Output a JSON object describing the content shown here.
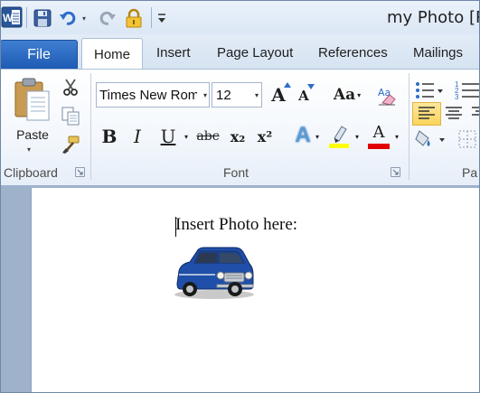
{
  "quick_access": {
    "app_icon": "word-icon",
    "save_icon": "save-icon",
    "undo_icon": "undo-icon",
    "undo_dropdown": "▾",
    "redo_icon": "redo-icon",
    "lock_icon": "lock-icon",
    "customize_icon": "customize-icon"
  },
  "window": {
    "title": "my Photo [Re"
  },
  "tabs": {
    "file": "File",
    "items": [
      "Home",
      "Insert",
      "Page Layout",
      "References",
      "Mailings"
    ],
    "active": "Home"
  },
  "ribbon": {
    "clipboard": {
      "label": "Clipboard",
      "paste_label": "Paste",
      "paste_dropdown": "▾",
      "icons": [
        "paste-icon",
        "cut-icon",
        "copy-icon",
        "format-painter-icon"
      ]
    },
    "font": {
      "label": "Font",
      "font_name": "Times New Rom",
      "font_size": "12",
      "dropdown_glyph": "▾",
      "grow_glyph": "A",
      "shrink_glyph": "A",
      "case_glyph": "Aa",
      "bold_glyph": "B",
      "italic_glyph": "I",
      "underline_glyph": "U",
      "strike_glyph": "abc",
      "subscript_glyph": "x₂",
      "superscript_glyph": "x²",
      "effects_glyph": "A",
      "color_glyph": "A",
      "highlight_color": "#ffff00",
      "font_color": "#e00000"
    },
    "paragraph": {
      "label": "Pa",
      "icons": [
        "bullets-icon",
        "numbering-icon",
        "align-left-icon",
        "align-center-icon",
        "align-right-icon",
        "shading-icon",
        "border-icon"
      ]
    }
  },
  "document": {
    "text": "Insert Photo here:",
    "image": "car-image"
  }
}
